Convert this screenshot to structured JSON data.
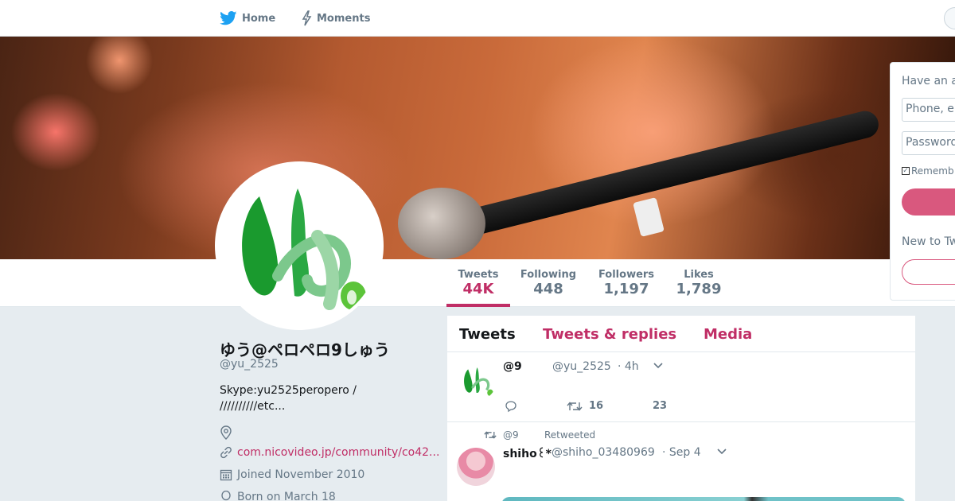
{
  "nav": {
    "home_label": "Home",
    "moments_label": "Moments"
  },
  "profile": {
    "name": "ゆう@ペロペロ9しゅう",
    "handle": "@yu_2525",
    "bio_line1": "Skype:yu2525peropero /",
    "bio_line2": "//////////etc...",
    "url": "com.nicovideo.jp/community/co42...",
    "joined": "Joined November 2010",
    "born": "Born on March 18"
  },
  "stats": [
    {
      "label": "Tweets",
      "value": "44K"
    },
    {
      "label": "Following",
      "value": "448"
    },
    {
      "label": "Followers",
      "value": "1,197"
    },
    {
      "label": "Likes",
      "value": "1,789"
    }
  ],
  "tabs": {
    "tweets": "Tweets",
    "replies": "Tweets & replies",
    "media": "Media"
  },
  "tweets": [
    {
      "name": "@9",
      "handle": "@yu_2525",
      "time": "· 4h",
      "retweets": "16",
      "likes": "23"
    },
    {
      "retweeted_by_name": "@9",
      "retweeted_label": "Retweeted",
      "name": "shiho꒰*",
      "handle": "@shiho_03480969",
      "time": "· Sep 4"
    }
  ],
  "login": {
    "header": "Have an a",
    "phone_placeholder": "Phone, e",
    "password_placeholder": "Password",
    "remember_label": "Rememb",
    "new_to": "New to Tw"
  },
  "colors": {
    "accent": "#c02e66",
    "button": "#d9587e",
    "brand_blue": "#1da1f2"
  }
}
